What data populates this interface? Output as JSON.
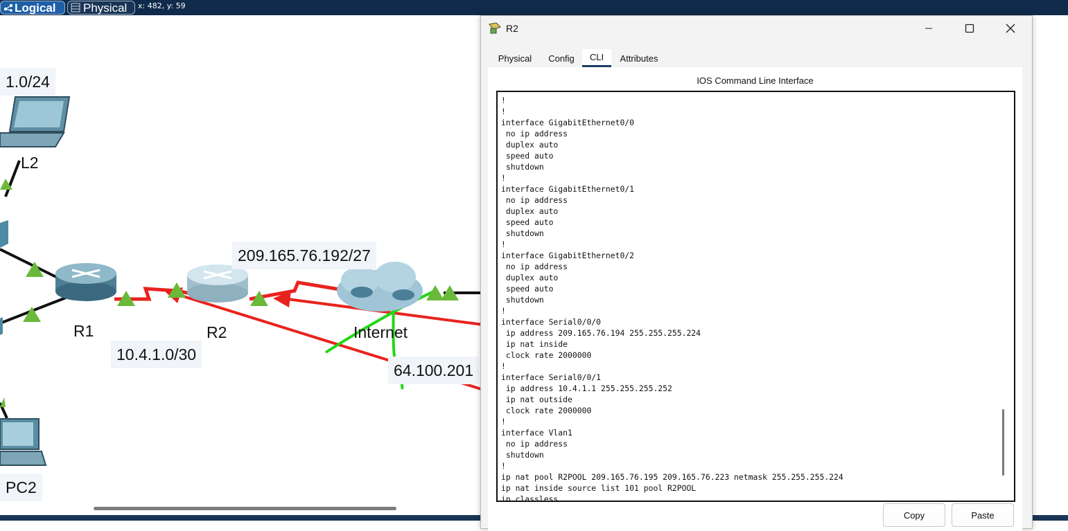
{
  "toolbar": {
    "logical_label": "Logical",
    "physical_label": "Physical",
    "coord_readout": "x: 482, y: 59"
  },
  "topology": {
    "labels": {
      "net_l2_partial": "1.0/24",
      "net_wan": "209.165.76.192/27",
      "net_r1r2": "10.4.1.0/30",
      "net_isp_partial": "64.100.201"
    },
    "devices": {
      "l2": "L2",
      "r1": "R1",
      "r2": "R2",
      "internet": "Internet",
      "pc2": "PC2"
    }
  },
  "window": {
    "title": "R2",
    "tabs": [
      "Physical",
      "Config",
      "CLI",
      "Attributes"
    ],
    "active_tab": "CLI",
    "cli_header": "IOS Command Line Interface",
    "cli_lines": [
      "!",
      "!",
      "interface GigabitEthernet0/0",
      " no ip address",
      " duplex auto",
      " speed auto",
      " shutdown",
      "!",
      "interface GigabitEthernet0/1",
      " no ip address",
      " duplex auto",
      " speed auto",
      " shutdown",
      "!",
      "interface GigabitEthernet0/2",
      " no ip address",
      " duplex auto",
      " speed auto",
      " shutdown",
      "!",
      "interface Serial0/0/0",
      " ip address 209.165.76.194 255.255.255.224",
      " ip nat inside",
      " clock rate 2000000",
      "!",
      "interface Serial0/0/1",
      " ip address 10.4.1.1 255.255.255.252",
      " ip nat outside",
      " clock rate 2000000",
      "!",
      "interface Vlan1",
      " no ip address",
      " shutdown",
      "!",
      "ip nat pool R2POOL 209.165.76.195 209.165.76.223 netmask 255.255.255.224",
      "ip nat inside source list 101 pool R2POOL",
      "ip classless"
    ],
    "copy_label": "Copy",
    "paste_label": "Paste"
  },
  "colors": {
    "link_red": "#e8231f",
    "annotation_green": "#22d616",
    "port_green": "#6ab93a"
  }
}
